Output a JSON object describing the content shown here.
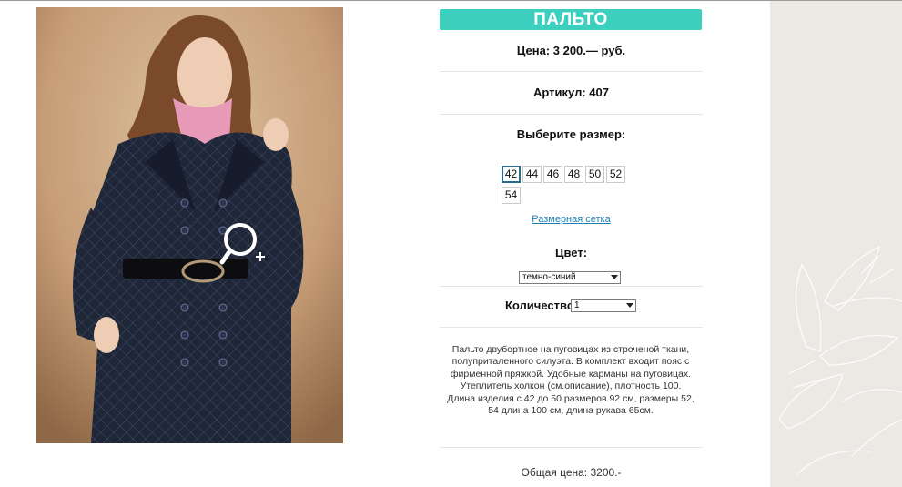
{
  "product": {
    "title": "ПАЛЬТО",
    "price": "Цена: 3 200.— руб.",
    "sku": "Артикул: 407",
    "size_prompt": "Выберите размер:",
    "sizes": [
      "42",
      "44",
      "46",
      "48",
      "50",
      "52",
      "54"
    ],
    "selected_size": "42",
    "size_chart_link": "Размерная сетка",
    "color_label": "Цвет:",
    "color_value": "темно-синий",
    "quantity_label": "Количество:",
    "quantity_value": "1",
    "description": "Пальто двубортное на пуговицах из строченой ткани, полуприталенного силуэта. В комплект входит пояс с фирменной пряжкой. Удобные карманы на пуговицах. Утеплитель холкон (см.описание), плотность 100. Длина изделия с 42 до 50 размеров 92 см, размеры 52, 54 длина 100 см, длина рукава 65см.",
    "total": "Общая цена: 3200.-"
  },
  "icons": {
    "zoom": "zoom-in-magnifier-icon",
    "dropdown": "chevron-down-icon"
  },
  "colors": {
    "accent": "#3ccfbe",
    "link": "#1f7fb5",
    "decor_bg": "#ece9e4"
  }
}
